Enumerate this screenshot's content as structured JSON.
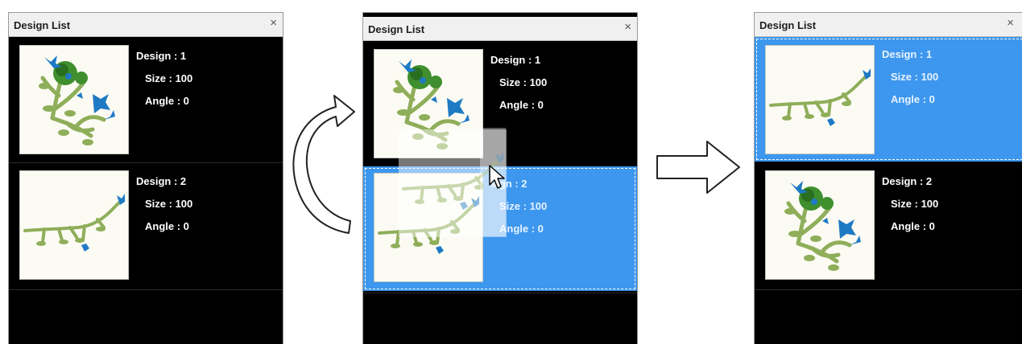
{
  "colors": {
    "list_bg": "#000000",
    "selected": "#3d97ee",
    "title_bg": "#f0f0f0",
    "stem": "#8fae5a",
    "flower": "#3f8f2e",
    "bird": "#1f7ac4"
  },
  "panels": [
    {
      "title": "Design List",
      "close": "×",
      "items": [
        {
          "design": "Design : 1",
          "size": "Size : 100",
          "angle": "Angle : 0",
          "thumbnail_icon": "floral-bouquet-icon"
        },
        {
          "design": "Design : 2",
          "size": "Size : 100",
          "angle": "Angle : 0",
          "thumbnail_icon": "floral-vine-icon"
        }
      ]
    },
    {
      "title": "Design List",
      "close": "×",
      "items": [
        {
          "design": "Design : 1",
          "size": "Size : 100",
          "angle": "Angle : 0",
          "thumbnail_icon": "floral-bouquet-icon"
        },
        {
          "design": "sign : 2",
          "size": "Size : 100",
          "angle": "Angle : 0",
          "thumbnail_icon": "floral-vine-icon",
          "selected": true
        }
      ],
      "drag_cursor_icon": "pointer-cursor-icon"
    },
    {
      "title": "Design List",
      "close": "×",
      "items": [
        {
          "design": "Design : 1",
          "size": "Size : 100",
          "angle": "Angle : 0",
          "thumbnail_icon": "floral-vine-icon",
          "selected": true
        },
        {
          "design": "Design : 2",
          "size": "Size : 100",
          "angle": "Angle : 0",
          "thumbnail_icon": "floral-bouquet-icon"
        }
      ]
    }
  ],
  "arrows": {
    "swap_icon": "curved-swap-arrow-icon",
    "next_icon": "right-arrow-icon"
  }
}
